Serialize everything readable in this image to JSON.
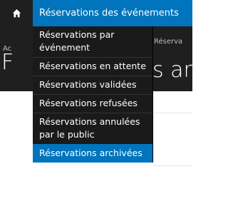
{
  "topbar": {
    "home_icon": "home-icon",
    "label": "Réservations des événements"
  },
  "background": {
    "breadcrumb_left": "Ac",
    "breadcrumb_right": "Réserva",
    "title_left": "F",
    "title_right": "s ar"
  },
  "menu": {
    "items": [
      {
        "label": "Réservations par événement",
        "active": false
      },
      {
        "label": "Réservations en attente",
        "active": false
      },
      {
        "label": "Réservations validées",
        "active": false
      },
      {
        "label": "Réservations refusées",
        "active": false
      },
      {
        "label": "Réservations annulées par le public",
        "active": false
      },
      {
        "label": "Réservations archivées",
        "active": true
      }
    ]
  },
  "colors": {
    "accent": "#0074bd",
    "dark": "#1a1a1a"
  }
}
